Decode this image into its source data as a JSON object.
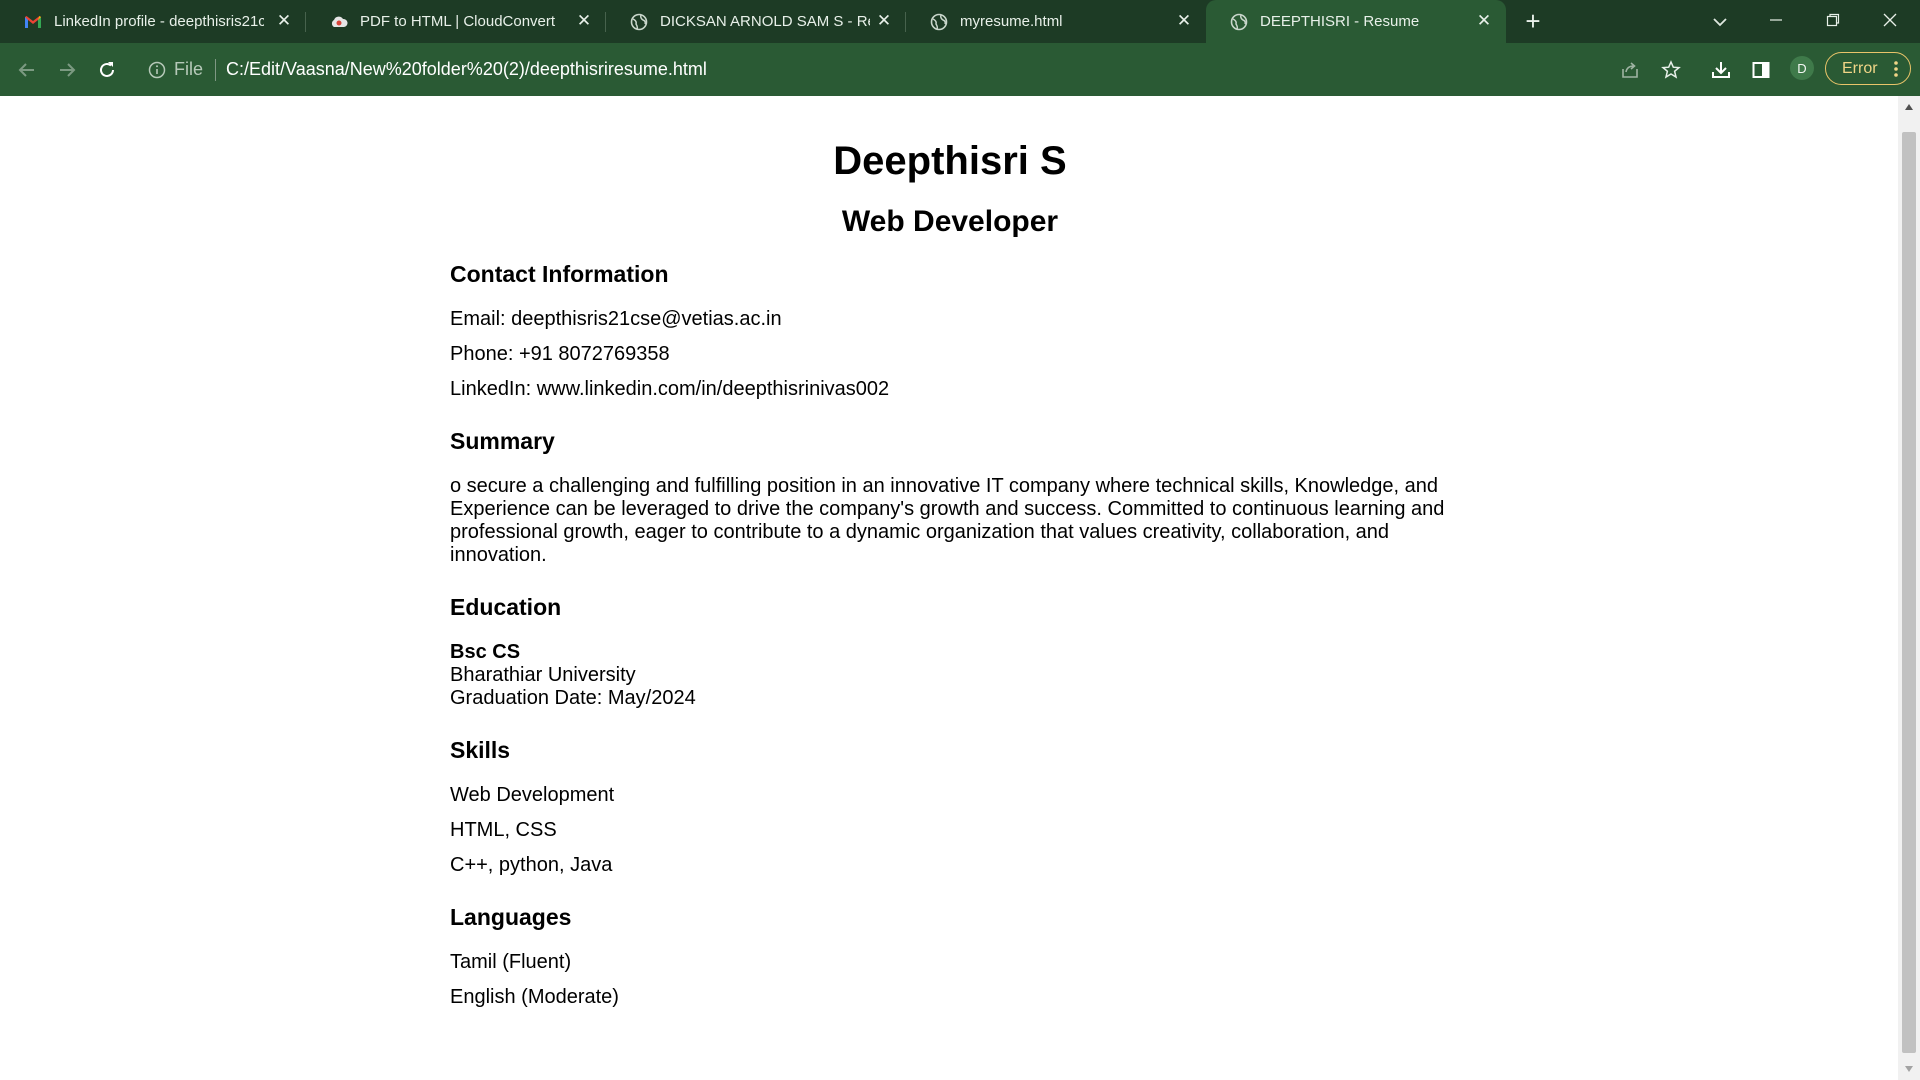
{
  "browser": {
    "tabs": [
      {
        "title": "LinkedIn profile - deepthisris21c",
        "favicon": "gmail-icon",
        "active": false
      },
      {
        "title": "PDF to HTML | CloudConvert",
        "favicon": "cloudconvert-icon",
        "active": false
      },
      {
        "title": "DICKSAN ARNOLD SAM S - Resu",
        "favicon": "globe-icon",
        "active": false
      },
      {
        "title": "myresume.html",
        "favicon": "globe-icon",
        "active": false
      },
      {
        "title": "DEEPTHISRI - Resume",
        "favicon": "globe-icon",
        "active": true
      }
    ],
    "address": {
      "scheme_label": "File",
      "url": "C:/Edit/Vaasna/New%20folder%20(2)/deepthisriresume.html"
    },
    "profile_initial": "D",
    "error_label": "Error",
    "colors": {
      "tabstrip_bg": "#1d3b25",
      "toolbar_bg": "#2a5a34",
      "error_accent": "#e9c46a"
    }
  },
  "resume": {
    "name": "Deepthisri S",
    "role": "Web Developer",
    "contact": {
      "heading": "Contact Information",
      "email": "Email: deepthisris21cse@vetias.ac.in",
      "phone": "Phone: +91 8072769358",
      "linkedin": "LinkedIn: www.linkedin.com/in/deepthisrinivas002"
    },
    "summary": {
      "heading": "Summary",
      "line1": "o secure a challenging and fulfilling position in an innovative IT company where technical skills, Knowledge, and",
      "line2": "Experience can be leveraged to drive the company's growth and success. Committed to continuous learning and",
      "line3": "professional growth, eager to contribute to a dynamic organization that values creativity, collaboration, and",
      "line4": "innovation."
    },
    "education": {
      "heading": "Education",
      "degree": "Bsc CS",
      "university": "Bharathiar University",
      "graduation": "Graduation Date: May/2024"
    },
    "skills": {
      "heading": "Skills",
      "items": [
        "Web Development",
        "HTML, CSS",
        "C++, python, Java"
      ]
    },
    "languages": {
      "heading": "Languages",
      "items": [
        "Tamil (Fluent)",
        "English (Moderate)"
      ]
    }
  }
}
